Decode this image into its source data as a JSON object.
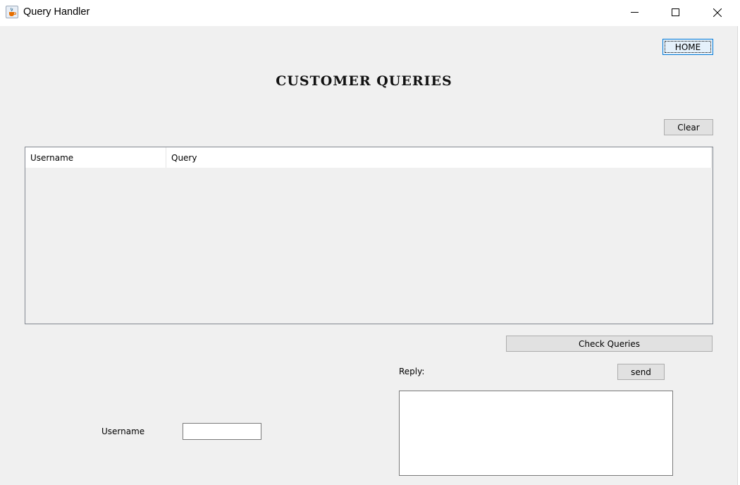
{
  "window": {
    "title": "Query Handler",
    "icon": "java-cup-icon"
  },
  "header": {
    "home_label": "HOME",
    "heading": "CUSTOMER QUERIES"
  },
  "toolbar": {
    "clear_label": "Clear",
    "check_queries_label": "Check Queries",
    "send_label": "send"
  },
  "table": {
    "columns": [
      "Username",
      "Query"
    ],
    "rows": []
  },
  "form": {
    "reply_label": "Reply:",
    "reply_value": "",
    "username_label": "Username",
    "username_value": ""
  },
  "colors": {
    "background": "#f0f0f0",
    "focus_border": "#0078d7"
  }
}
